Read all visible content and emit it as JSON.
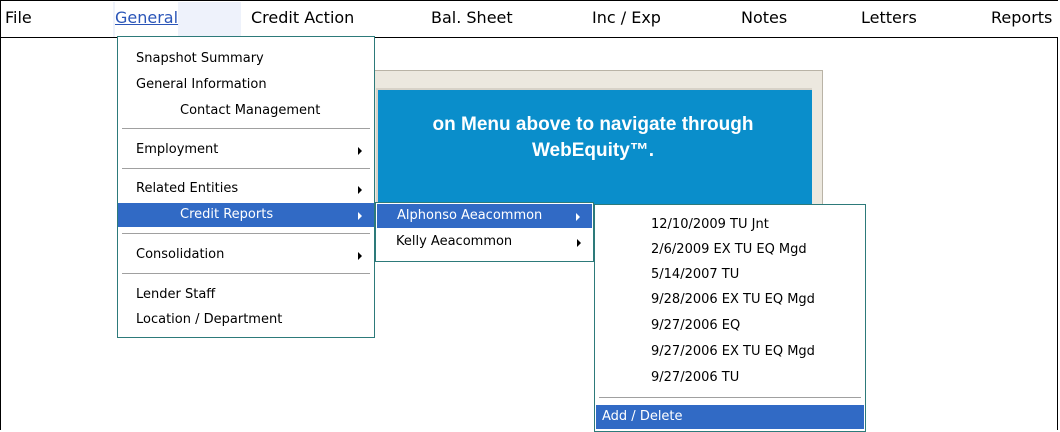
{
  "menubar": {
    "items": [
      {
        "label": "File"
      },
      {
        "label": "General"
      },
      {
        "label": "Credit Action"
      },
      {
        "label": "Bal. Sheet"
      },
      {
        "label": "Inc / Exp"
      },
      {
        "label": "Notes"
      },
      {
        "label": "Letters"
      },
      {
        "label": "Reports"
      }
    ]
  },
  "banner": {
    "line1": "on Menu above to navigate through",
    "line2": "WebEquity™."
  },
  "general_menu": {
    "items": [
      {
        "label": "Snapshot Summary"
      },
      {
        "label": "General Information"
      },
      {
        "label": "Contact Management"
      },
      {
        "label": "Employment"
      },
      {
        "label": "Related Entities"
      },
      {
        "label": "Credit Reports"
      },
      {
        "label": "Consolidation"
      },
      {
        "label": "Lender Staff"
      },
      {
        "label": "Location / Department"
      }
    ]
  },
  "credit_reports_menu": {
    "items": [
      {
        "label": "Alphonso Aeacommon"
      },
      {
        "label": "Kelly Aeacommon"
      }
    ]
  },
  "reports_menu": {
    "items": [
      {
        "label": "12/10/2009 TU Jnt"
      },
      {
        "label": "2/6/2009 EX TU EQ Mgd"
      },
      {
        "label": "5/14/2007 TU"
      },
      {
        "label": "9/28/2006 EX TU EQ Mgd"
      },
      {
        "label": "9/27/2006 EQ"
      },
      {
        "label": "9/27/2006 EX TU EQ Mgd"
      },
      {
        "label": "9/27/2006 TU"
      },
      {
        "label": "Add / Delete"
      }
    ]
  },
  "colors": {
    "highlight": "#316ac5",
    "banner": "#0a8ecb",
    "menu_border": "#2d7a7a"
  }
}
